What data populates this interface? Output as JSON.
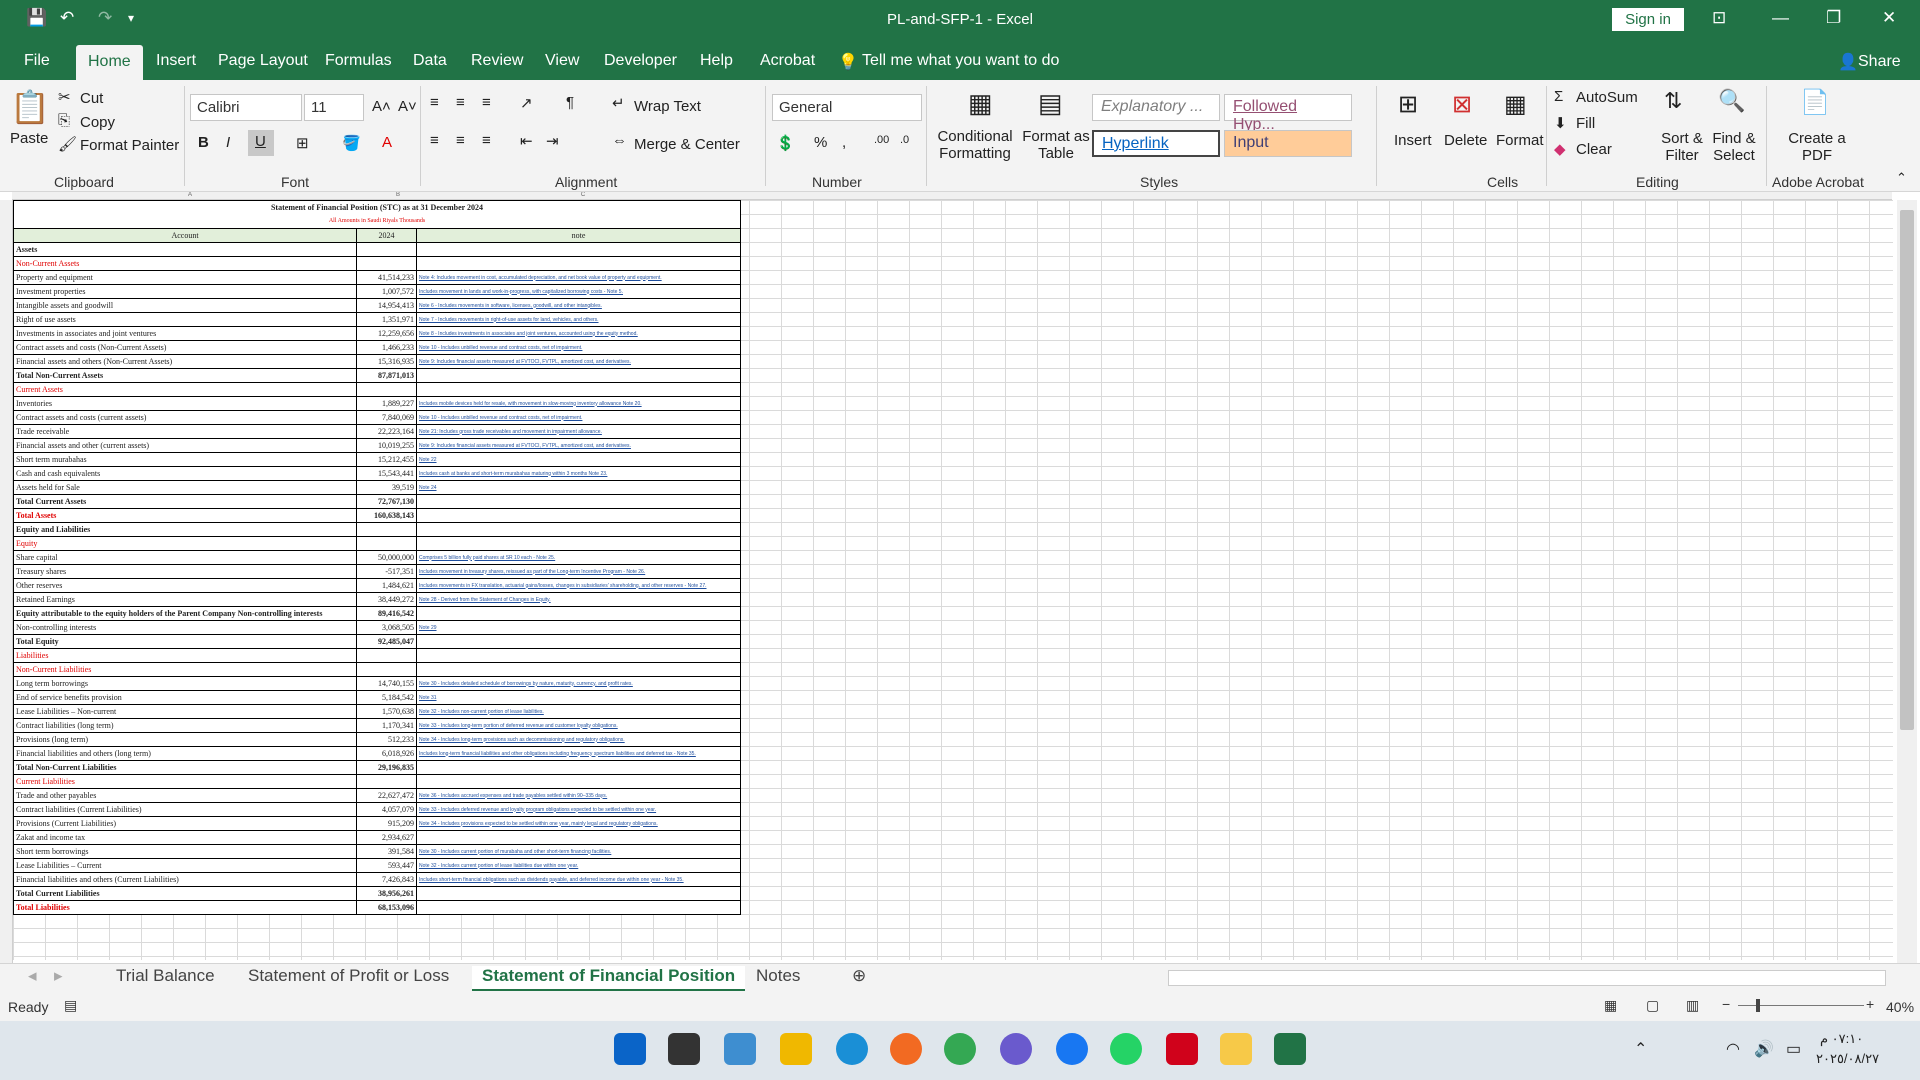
{
  "window": {
    "title": "PL-and-SFP-1  -  Excel",
    "sign_in": "Sign in"
  },
  "ribbon_tabs": [
    "File",
    "Home",
    "Insert",
    "Page Layout",
    "Formulas",
    "Data",
    "Review",
    "View",
    "Developer",
    "Help",
    "Acrobat"
  ],
  "tell_me": "Tell me what you want to do",
  "share": "Share",
  "clipboard": {
    "paste": "Paste",
    "cut": "Cut",
    "copy": "Copy",
    "format_painter": "Format Painter",
    "group": "Clipboard"
  },
  "font": {
    "name": "Calibri",
    "size": "11",
    "group": "Font"
  },
  "alignment": {
    "wrap": "Wrap Text",
    "merge": "Merge & Center",
    "group": "Alignment"
  },
  "number": {
    "format": "General",
    "group": "Number"
  },
  "styles": {
    "cond": "Conditional Formatting",
    "table": "Format as Table",
    "explanatory": "Explanatory ...",
    "followed": "Followed Hyp...",
    "hyperlink": "Hyperlink",
    "input": "Input",
    "group": "Styles"
  },
  "cells": {
    "insert": "Insert",
    "delete": "Delete",
    "format": "Format",
    "group": "Cells"
  },
  "editing": {
    "autosum": "AutoSum",
    "fill": "Fill",
    "clear": "Clear",
    "sort": "Sort & Filter",
    "find": "Find & Select",
    "group": "Editing"
  },
  "acrobat": {
    "create": "Create a PDF",
    "group": "Adobe Acrobat"
  },
  "sheet": {
    "title": "Statement of Financial Position (STC) as at 31 December 2024",
    "subtitle": "All Amounts in Saudi Riyals Thousands",
    "headers": [
      "Account",
      "2024",
      "note"
    ],
    "rows": [
      [
        "Assets",
        "",
        ""
      ],
      [
        "Non-Current Assets",
        "",
        ""
      ],
      [
        "Property and equipment",
        "41,514,233",
        "Note 4: Includes movement in cost, accumulated depreciation, and net book value of property and equipment."
      ],
      [
        "Investment properties",
        "1,007,572",
        "Includes movement in lands and work-in-progress, with capitalized borrowing costs - Note 5."
      ],
      [
        "Intangible assets and goodwill",
        "14,954,413",
        "Note 6 - Includes movements in software, licenses, goodwill, and other intangibles."
      ],
      [
        "Right of use assets",
        "1,351,971",
        "Note 7 - Includes movements in right-of-use assets for land, vehicles, and others."
      ],
      [
        "Investments in associates and joint ventures",
        "12,259,656",
        "Note 8 - Includes investments in associates and joint ventures, accounted using the equity method."
      ],
      [
        "Contract assets and costs (Non-Current Assets)",
        "1,466,233",
        "Note 10 - Includes unbilled revenue and contract costs, net of impairment."
      ],
      [
        "Financial assets and others (Non-Current Assets)",
        "15,316,935",
        "Note 9: Includes financial assets measured at FVTOCI, FVTPL, amortized cost, and derivatives."
      ],
      [
        "Total Non-Current Assets",
        "87,871,013",
        ""
      ],
      [
        "Current Assets",
        "",
        ""
      ],
      [
        "Inventories",
        "1,889,227",
        "Includes mobile devices held for resale, with movement in slow-moving inventory allowance Note 20."
      ],
      [
        "Contract assets and costs (current assets)",
        "7,840,069",
        "Note 10 - Includes unbilled revenue and contract costs, net of impairment."
      ],
      [
        "Trade receivable",
        "22,223,164",
        "Note 21: Includes gross trade receivables and movement in impairment allowance."
      ],
      [
        "Financial assets and other (current assets)",
        "10,019,255",
        "Note 9: Includes financial assets measured at FVTOCI, FVTPL, amortized cost, and derivatives."
      ],
      [
        "Short term murabahas",
        "15,212,455",
        "Note 22"
      ],
      [
        "Cash and cash equivalents",
        "15,543,441",
        "Includes cash at banks and short-term murabahas maturing within 3 months Note 23."
      ],
      [
        "Assets held for Sale",
        "39,519",
        "Note 24"
      ],
      [
        "Total Current Assets",
        "72,767,130",
        ""
      ],
      [
        "Total Assets",
        "160,638,143",
        ""
      ],
      [
        "Equity and Liabilities",
        "",
        ""
      ],
      [
        "Equity",
        "",
        ""
      ],
      [
        "Share capital",
        "50,000,000",
        "Comprises 5 billion fully paid shares at SR 10 each - Note 25."
      ],
      [
        "Treasury shares",
        "-517,351",
        "Includes movement in treasury shares, reissued as part of the Long-term Incentive Program - Note 26."
      ],
      [
        "Other reserves",
        "1,484,621",
        "Includes movements in FX translation, actuarial gains/losses, changes in subsidiaries' shareholding, and other reserves - Note 27."
      ],
      [
        "Retained Earnings",
        "38,449,272",
        "Note 28 - Derived from the Statement of Changes in Equity."
      ],
      [
        "Equity attributable to the equity holders of the Parent Company Non-controlling interests",
        "89,416,542",
        ""
      ],
      [
        "Non-controlling interests",
        "3,068,505",
        "Note 29"
      ],
      [
        "Total Equity",
        "92,485,047",
        ""
      ],
      [
        "Liabilities",
        "",
        ""
      ],
      [
        "Non-Current Liabilities",
        "",
        ""
      ],
      [
        "Long term borrowings",
        "14,740,155",
        "Note 30 - Includes detailed schedule of borrowings by nature, maturity, currency, and profit rates."
      ],
      [
        "End of service benefits provision",
        "5,184,542",
        "Note 31"
      ],
      [
        "Lease Liabilities – Non-current",
        "1,570,638",
        "Note 32 - Includes non-current portion of lease liabilities."
      ],
      [
        "Contract liabilities (long term)",
        "1,170,341",
        "Note 33 - Includes long-term portion of deferred revenue and customer loyalty obligations."
      ],
      [
        "Provisions  (long term)",
        "512,233",
        "Note 34 - Includes long-term provisions such as decommissioning and regulatory obligations."
      ],
      [
        "Financial liabilities and others (long term)",
        "6,018,926",
        "Includes long-term financial liabilities and other obligations including frequency spectrum liabilities and deferred tax - Note 35."
      ],
      [
        "Total Non-Current Liabilities",
        "29,196,835",
        ""
      ],
      [
        "Current Liabilities",
        "",
        ""
      ],
      [
        "Trade and other payables",
        "22,627,472",
        "Note 36 - Includes accrued expenses and trade payables settled within 90–335 days."
      ],
      [
        "Contract liabilities (Current Liabilities)",
        "4,057,079",
        "Note 33 - Includes deferred revenue and loyalty program obligations expected to be settled within one year."
      ],
      [
        "Provisions (Current Liabilities)",
        "915,209",
        "Note 34 - Includes provisions expected to be settled within one year, mainly legal and regulatory obligations."
      ],
      [
        "Zakat and income tax",
        "2,934,627",
        ""
      ],
      [
        "Short term borrowings",
        "391,584",
        "Note 30 - Includes current portion of murabaha and other short-term financing facilities."
      ],
      [
        "Lease Liabilities – Current",
        "593,447",
        "Note 32 - Includes current portion of lease liabilities due within one year."
      ],
      [
        "Financial liabilities and others (Current Liabilities)",
        "7,426,843",
        "Includes short-term financial obligations such as dividends payable, and deferred income due within one year - Note 35."
      ],
      [
        "Total Current Liabilities",
        "38,956,261",
        ""
      ],
      [
        "Total Liabilities",
        "68,153,096",
        ""
      ]
    ]
  },
  "sheet_tabs": [
    "Trial Balance",
    "Statement of Profit or Loss",
    "Statement of Financial Position",
    "Notes"
  ],
  "status": {
    "ready": "Ready",
    "zoom": "40%"
  },
  "clock": {
    "time": "٠٧:١٠ م",
    "date": "٢٠٢٥/٠٨/٢٧"
  }
}
